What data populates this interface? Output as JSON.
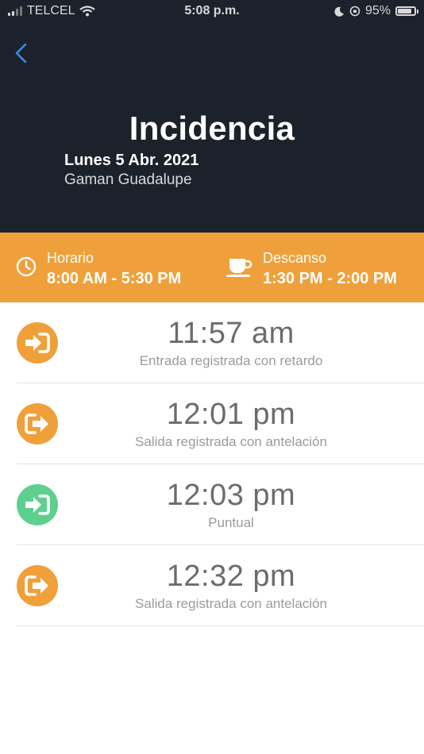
{
  "status_bar": {
    "carrier": "TELCEL",
    "time": "5:08 p.m.",
    "battery": "95%",
    "battery_level": 0.95,
    "icons": [
      "signal-icon",
      "wifi-icon",
      "moon-icon",
      "orientation-lock-icon",
      "battery-icon"
    ]
  },
  "header": {
    "back_icon": "chevron-left-icon",
    "title": "Incidencia",
    "date": "Lunes 5 Abr. 2021",
    "person": "Gaman Guadalupe"
  },
  "schedule": {
    "horario": {
      "icon": "clock-icon",
      "label": "Horario",
      "value": "8:00 AM - 5:30 PM"
    },
    "descanso": {
      "icon": "coffee-cup-icon",
      "label": "Descanso",
      "value": "1:30 PM - 2:00 PM"
    }
  },
  "records": [
    {
      "icon": "sign-in-icon",
      "color": "#f0a03a",
      "time": "11:57 am",
      "description": "Entrada registrada con retardo"
    },
    {
      "icon": "sign-out-icon",
      "color": "#f0a03a",
      "time": "12:01 pm",
      "description": "Salida registrada con antelación"
    },
    {
      "icon": "sign-in-icon",
      "color": "#5fcf8f",
      "time": "12:03 pm",
      "description": "Puntual"
    },
    {
      "icon": "sign-out-icon",
      "color": "#f0a03a",
      "time": "12:32 pm",
      "description": "Salida registrada con antelación"
    }
  ],
  "colors": {
    "header_bg": "#1c222b",
    "accent_orange": "#f0a03a",
    "accent_green": "#5fcf8f",
    "link_blue": "#3a8fe0"
  }
}
